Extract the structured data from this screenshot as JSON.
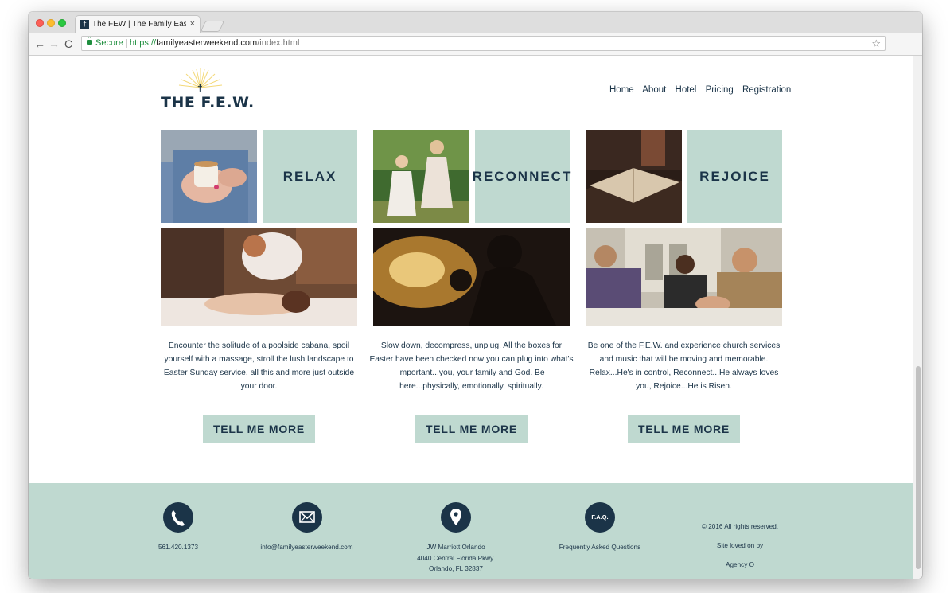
{
  "browser": {
    "tab_title": "The FEW | The Family Easter W",
    "tab_close": "×",
    "favicon": "†",
    "secure_label": "Secure",
    "url_protocol": "https://",
    "url_host": "familyeasterweekend.com",
    "url_path": "/index.html",
    "back": "←",
    "forward": "→",
    "reload": "C",
    "bookmark": "☆"
  },
  "header": {
    "logo_text": "THE F.E.W.",
    "logo_cross": "†",
    "nav": [
      "Home",
      "About",
      "Hotel",
      "Pricing",
      "Registration"
    ]
  },
  "columns": [
    {
      "tile": "RELAX",
      "description": "Encounter the solitude of a poolside cabana, spoil yourself with a massage, stroll the lush landscape to Easter Sunday service, all this and more just outside your door.",
      "cta": "TELL ME MORE"
    },
    {
      "tile": "RECONNECT",
      "description": "Slow down, decompress, unplug. All the boxes for Easter have been checked now you can plug into what's important...you, your family and God. Be here...physically, emotionally, spiritually.",
      "cta": "TELL ME MORE"
    },
    {
      "tile": "REJOICE",
      "description": "Be one of the F.E.W. and experience church services and music that will be moving and memorable. Relax...He's in control, Reconnect...He always loves you, Rejoice...He is Risen.",
      "cta": "TELL ME MORE"
    }
  ],
  "footer": {
    "phone": "561.420.1373",
    "email": "info@familyeasterweekend.com",
    "address_line1": "JW Marriott Orlando",
    "address_line2": "4040 Central Florida Pkwy.",
    "address_line3": "Orlando, FL 32837",
    "faq_badge": "F.A.Q.",
    "faq_label": "Frequently Asked Questions",
    "copyright": "© 2016 All rights reserved.",
    "credit_line1": "Site loved on by",
    "credit_line2": "Agency O"
  },
  "colors": {
    "navy": "#1b3448",
    "mint": "#bfd9d0"
  },
  "icons": [
    "phone-icon",
    "envelope-icon",
    "map-pin-icon",
    "faq-icon"
  ]
}
